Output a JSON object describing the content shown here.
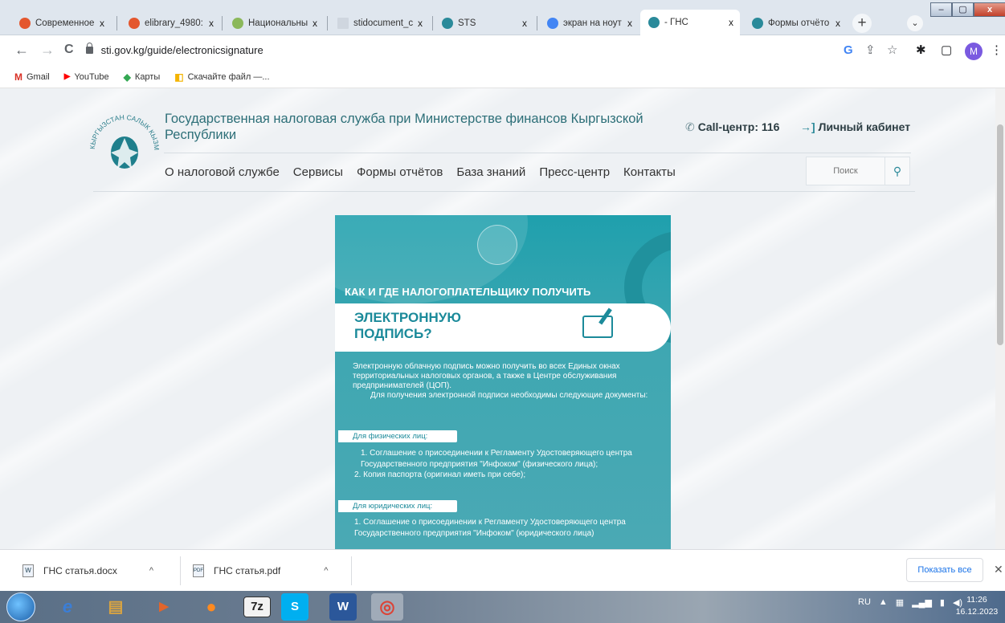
{
  "browser": {
    "tabs": [
      {
        "title": "Современное",
        "favicon_color": "#e4572e"
      },
      {
        "title": "elibrary_4980:",
        "favicon_color": "#e4572e"
      },
      {
        "title": "Национальны",
        "favicon_color": "#8bb85a"
      },
      {
        "title": "stidocument_c",
        "favicon_color": "#cfd6df"
      },
      {
        "title": "STS",
        "favicon_color": "#2a8a9a"
      },
      {
        "title": "экран на ноут",
        "favicon_color": "#4285f4"
      },
      {
        "title": "- ГНС",
        "favicon_color": "#2a8a9a"
      },
      {
        "title": "Формы отчёто",
        "favicon_color": "#2a8a9a"
      }
    ],
    "close_glyph": "x",
    "new_tab_glyph": "+",
    "tab_menu_glyph": "⌄",
    "window_buttons": {
      "minimize": "–",
      "maximize": "▢",
      "close": "x"
    },
    "address": "sti.gov.kg/guide/electronicsignature",
    "nav": {
      "back": "←",
      "forward": "→",
      "reload": "C"
    },
    "toolbar_icons": {
      "google": "G",
      "share": "⇪",
      "star": "☆",
      "extensions": "✱",
      "sidepanel": "▢",
      "menu": "⋮"
    },
    "profile_initial": "M",
    "bookmarks": [
      {
        "label": "Gmail",
        "icon": "gmail-icon",
        "glyph": "M",
        "color": "#d93025"
      },
      {
        "label": "YouTube",
        "icon": "youtube-icon",
        "glyph": "▶",
        "color": "#ff0000"
      },
      {
        "label": "Карты",
        "icon": "maps-icon",
        "glyph": "◆",
        "color": "#34a853"
      },
      {
        "label": "Скачайте файл —...",
        "icon": "bookmark-icon",
        "glyph": "◧",
        "color": "#f4b400"
      }
    ]
  },
  "site": {
    "title": "Государственная налоговая служба при Министерстве финансов Кыргызской Республики",
    "call_center": "Call-центр: 116",
    "cabinet": "Личный кабинет",
    "nav": [
      "О налоговой службе",
      "Сервисы",
      "Формы отчётов",
      "База знаний",
      "Пресс-центр",
      "Контакты"
    ],
    "search_placeholder": "Поиск",
    "logo_text": "КЫРГЫЗСТАН САЛЫК КЫЗМАТЫ"
  },
  "poster": {
    "kicker": "КАК И ГДЕ НАЛОГОПЛАТЕЛЬЩИКУ ПОЛУЧИТЬ",
    "headline_1": "ЭЛЕКТРОННУЮ",
    "headline_2": "ПОДПИСЬ?",
    "intro_1": "Электронную облачную подпись можно получить во всех Единых окнах территориальных налоговых органов, а также в Центре обслуживания предпринимателей (ЦОП).",
    "intro_2": "Для получения электронной подписи необходимы следующие документы:",
    "individuals_chip": "Для физических лиц:",
    "individuals_item_1": "1. Соглашение о присоединении к Регламенту Удостоверяющего центра Государственного предприятия \"Инфоком\" (физического лица);",
    "individuals_item_2": "2. Копия паспорта (оригинал иметь при себе);",
    "legal_chip": "Для юридических лиц:",
    "legal_item_1": "1. Соглашение о присоединении к Регламенту Удостоверяющего центра Государственного предприятия \"Инфоком\" (юридического лица)"
  },
  "downloads": {
    "files": [
      {
        "name": "ГНС статья.docx",
        "type": "W"
      },
      {
        "name": "ГНС статья.pdf",
        "type": "PDF"
      }
    ],
    "show_all": "Показать все",
    "close_glyph": "✕",
    "chevron_glyph": "^"
  },
  "taskbar": {
    "apps": [
      {
        "name": "internet-explorer",
        "glyph": "e",
        "color": "#3b7ed6"
      },
      {
        "name": "file-explorer",
        "glyph": "▤",
        "color": "#d9a441"
      },
      {
        "name": "media-player",
        "glyph": "▶",
        "color": "#e2652b"
      },
      {
        "name": "firefox",
        "glyph": "●",
        "color": "#ff8a1f"
      },
      {
        "name": "7zip",
        "glyph": "7z",
        "color": "#222222"
      },
      {
        "name": "skype",
        "glyph": "S",
        "color": "#00aff0"
      },
      {
        "name": "word",
        "glyph": "W",
        "color": "#2b579a"
      },
      {
        "name": "chrome",
        "glyph": "◎",
        "color": "#db4437"
      }
    ],
    "language": "RU",
    "time": "11:26",
    "date": "16.12.2023"
  }
}
